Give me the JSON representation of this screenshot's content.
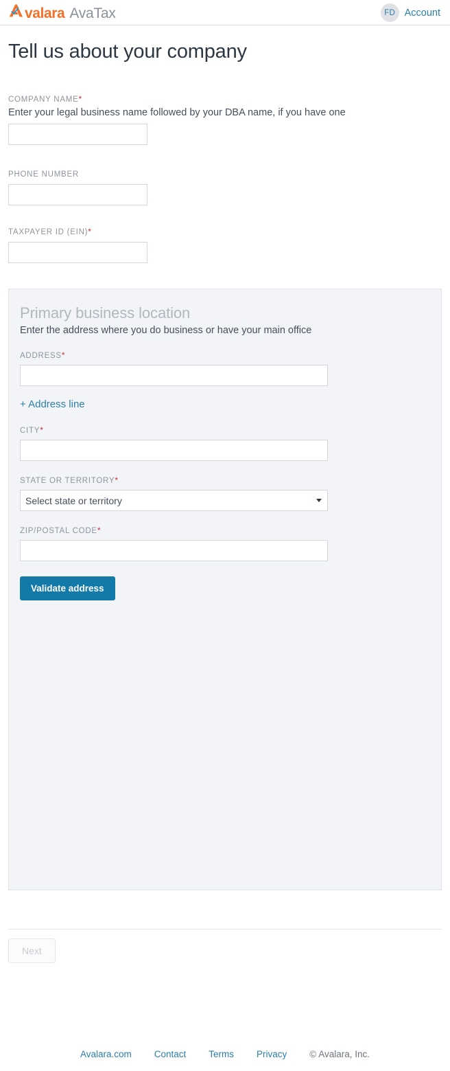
{
  "brand": {
    "logo_word": "valara",
    "logo_product": "AvaTax",
    "logo_orange": "#f2702a",
    "logo_gray": "#8b9199",
    "accent_blue": "#2b7fa8",
    "button_blue": "#1279a8",
    "required_red": "#c42b3b"
  },
  "header": {
    "avatar_initials": "FD",
    "account_label": "Account"
  },
  "page_title": "Tell us about your company",
  "fields": {
    "company_name": {
      "label": "COMPANY NAME",
      "required_marker": "*",
      "help": "Enter your legal business name followed by your DBA name, if you have one",
      "value": "",
      "placeholder": ""
    },
    "phone_number": {
      "label": "PHONE NUMBER",
      "required_marker": "",
      "value": "",
      "placeholder": ""
    },
    "taxpayer_id": {
      "label": "TAXPAYER ID (EIN)",
      "required_marker": "*",
      "value": "",
      "placeholder": ""
    }
  },
  "panel": {
    "title": "Primary business location",
    "subtitle": "Enter the address where you do business or have your main office",
    "address": {
      "label": "ADDRESS",
      "required_marker": "*",
      "value": "",
      "placeholder": ""
    },
    "add_address_line_link": "+ Address line",
    "city": {
      "label": "CITY",
      "required_marker": "*",
      "value": "",
      "placeholder": ""
    },
    "state": {
      "label": "STATE OR TERRITORY",
      "required_marker": "*",
      "selected": "Select state or territory",
      "options": [
        "Select state or territory"
      ]
    },
    "zip": {
      "label": "ZIP/POSTAL CODE",
      "required_marker": "*",
      "value": "",
      "placeholder": ""
    },
    "validate_button": "Validate address"
  },
  "nav": {
    "next_button": "Next",
    "next_disabled": true
  },
  "footer": {
    "links": [
      {
        "label": "Avalara.com"
      },
      {
        "label": "Contact"
      },
      {
        "label": "Terms"
      },
      {
        "label": "Privacy"
      }
    ],
    "copyright": "© Avalara, Inc."
  }
}
